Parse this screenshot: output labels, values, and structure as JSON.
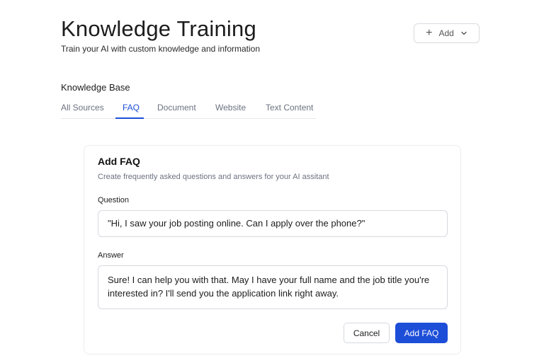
{
  "header": {
    "title": "Knowledge Training",
    "subtitle": "Train your AI with custom knowledge and information",
    "add_button": {
      "label": "Add",
      "icon": "plus-icon",
      "trailing_icon": "chevron-down-icon"
    }
  },
  "knowledge_base": {
    "heading": "Knowledge Base",
    "tabs": [
      {
        "label": "All Sources",
        "active": false
      },
      {
        "label": "FAQ",
        "active": true
      },
      {
        "label": "Document",
        "active": false
      },
      {
        "label": "Website",
        "active": false
      },
      {
        "label": "Text Content",
        "active": false
      }
    ]
  },
  "faq_form": {
    "title": "Add FAQ",
    "description": "Create frequently asked questions and answers for your AI assitant",
    "question_label": "Question",
    "question_value": "\"Hi, I saw your job posting online. Can I apply over the phone?\"",
    "answer_label": "Answer",
    "answer_value": "Sure! I can help you with that. May I have your full name and the job title you're interested in? I'll send you the application link right away.",
    "cancel_label": "Cancel",
    "submit_label": "Add FAQ"
  },
  "colors": {
    "accent": "#1d4ed8",
    "text_primary": "#1c1c1c",
    "text_muted": "#6b7280",
    "border": "#d6d9df"
  }
}
